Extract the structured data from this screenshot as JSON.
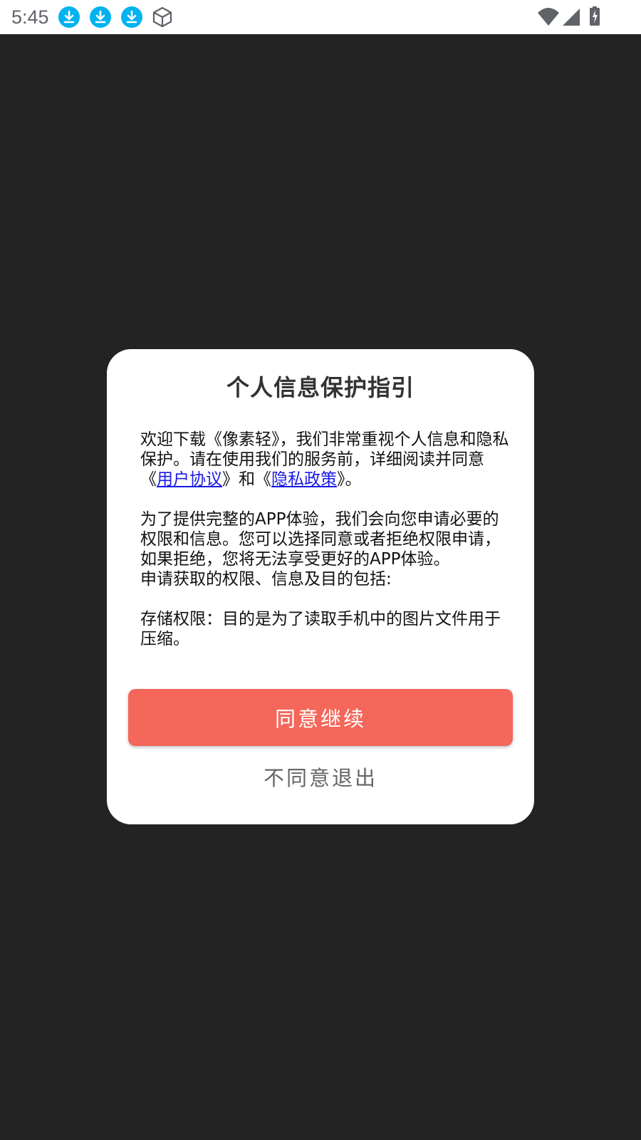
{
  "status_bar": {
    "time": "5:45",
    "notification_icons": [
      "download-icon",
      "download-icon",
      "download-icon",
      "cube-icon"
    ],
    "right_icons": [
      "wifi-icon",
      "signal-icon",
      "battery-charging-icon"
    ],
    "icon_color": "#00b2f0"
  },
  "dialog": {
    "title": "个人信息保护指引",
    "paragraph1": {
      "prefix": "欢迎下载《像素轻》，我们非常重视个人信息和隐私保护。请在使用我们的服务前，详细阅读并同意《",
      "link1": "用户协议",
      "middle": "》和《",
      "link2": "隐私政策",
      "suffix": "》。"
    },
    "paragraph2": "为了提供完整的APP体验，我们会向您申请必要的权限和信息。您可以选择同意或者拒绝权限申请，如果拒绝，您将无法享受更好的APP体验。",
    "paragraph3": "申请获取的权限、信息及目的包括:",
    "paragraph4": "存储权限：目的是为了读取手机中的图片文件用于压缩。",
    "agree_label": "同意继续",
    "disagree_label": "不同意退出",
    "accent_color": "#f4675a",
    "link_color": "#1a1ae6"
  }
}
